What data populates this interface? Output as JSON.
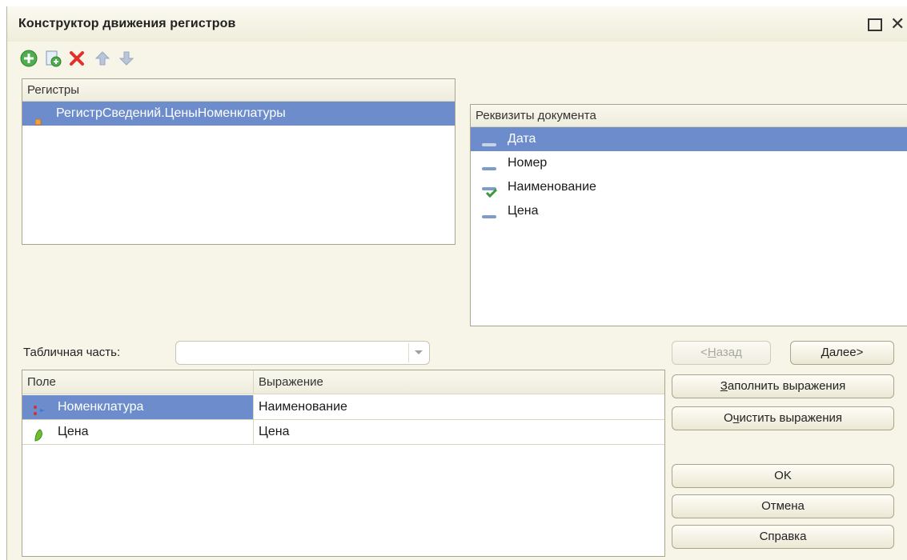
{
  "window": {
    "title": "Конструктор движения регистров"
  },
  "toolbar": [
    "add-icon",
    "add-copy-icon",
    "delete-icon",
    "move-up-icon",
    "move-down-icon"
  ],
  "registers": {
    "header": "Регистры",
    "items": [
      {
        "label": "РегистрСведений.ЦеныНоменклатуры",
        "selected": true
      }
    ]
  },
  "attributes": {
    "header": "Реквизиты документа",
    "items": [
      {
        "label": "Дата",
        "icon": "attribute-icon",
        "selected": true
      },
      {
        "label": "Номер",
        "icon": "attribute-icon"
      },
      {
        "label": "Наименование",
        "icon": "attribute-check-icon"
      },
      {
        "label": "Цена",
        "icon": "attribute-icon"
      }
    ]
  },
  "tabular": {
    "label": "Табличная часть:",
    "value": ""
  },
  "fields_table": {
    "columns": [
      "Поле",
      "Выражение"
    ],
    "rows": [
      {
        "field": "Номенклатура",
        "expression": "Наименование",
        "icon": "dimension-icon",
        "selected": true
      },
      {
        "field": "Цена",
        "expression": "Цена",
        "icon": "resource-icon"
      }
    ]
  },
  "buttons": {
    "back": {
      "prefix": "<",
      "hot": "Н",
      "rest": "азад"
    },
    "next": {
      "hot": "Д",
      "rest": "алее>"
    },
    "fill": {
      "hot": "З",
      "rest": "аполнить выражения"
    },
    "clear": {
      "pre": "О",
      "hot": "ч",
      "rest": "истить выражения"
    },
    "ok": "OK",
    "cancel": "Отмена",
    "help": "Справка"
  },
  "colors": {
    "selection": "#6d8ccc",
    "window_bg": "#f7f5e8"
  }
}
